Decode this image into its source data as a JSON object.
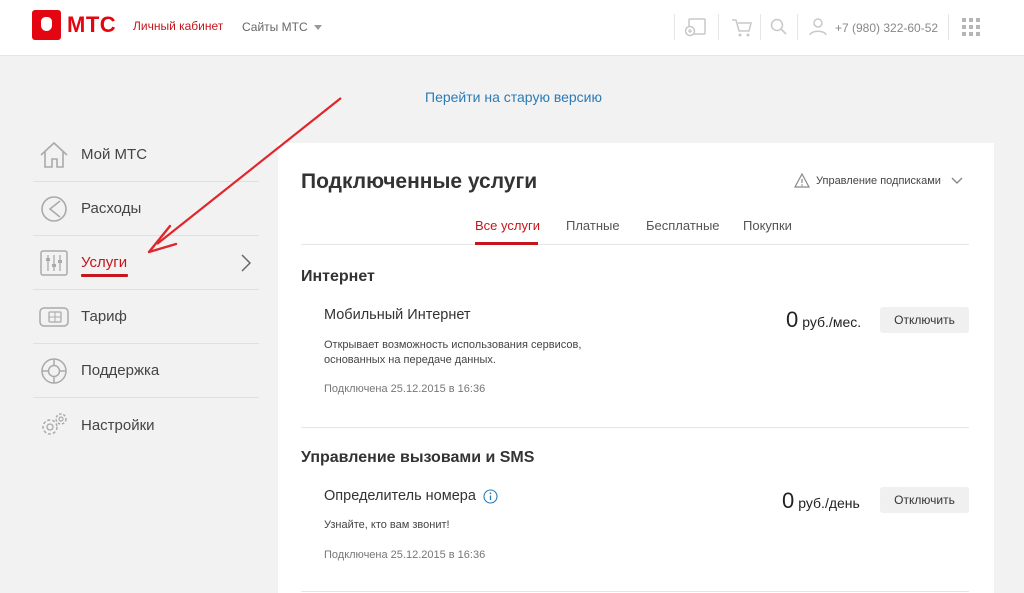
{
  "header": {
    "logo_text": "МТС",
    "personal_cabinet": "Личный кабинет",
    "sites": "Сайты МТС",
    "phone": "+7 (980) 322-60-52"
  },
  "top_link": "Перейти на старую версию",
  "sidebar": {
    "items": [
      {
        "label": "Мой МТС",
        "icon": "home-icon"
      },
      {
        "label": "Расходы",
        "icon": "pie-chart-icon"
      },
      {
        "label": "Услуги",
        "icon": "sliders-icon"
      },
      {
        "label": "Тариф",
        "icon": "sim-card-icon"
      },
      {
        "label": "Поддержка",
        "icon": "lifebuoy-icon"
      },
      {
        "label": "Настройки",
        "icon": "gears-icon"
      }
    ],
    "active_index": 2
  },
  "main": {
    "title": "Подключенные услуги",
    "manage_subscriptions": "Управление подписками",
    "tabs": [
      "Все услуги",
      "Платные",
      "Бесплатные",
      "Покупки"
    ],
    "sections": [
      {
        "title": "Интернет",
        "service": {
          "name": "Мобильный Интернет",
          "description": "Открывает возможность использования сервисов, основанных на передаче данных.",
          "connected": "Подключена 25.12.2015 в 16:36",
          "price": "0",
          "unit": "руб./мес.",
          "button": "Отключить"
        }
      },
      {
        "title": "Управление вызовами и SMS",
        "service": {
          "name": "Определитель номера",
          "description": "Узнайте, кто вам звонит!",
          "connected": "Подключена 25.12.2015 в 16:36",
          "price": "0",
          "unit": "руб./день",
          "button": "Отключить"
        }
      }
    ]
  },
  "colors": {
    "brand": "#e30611",
    "accent": "#c4161c",
    "link": "#2b7bb5"
  }
}
